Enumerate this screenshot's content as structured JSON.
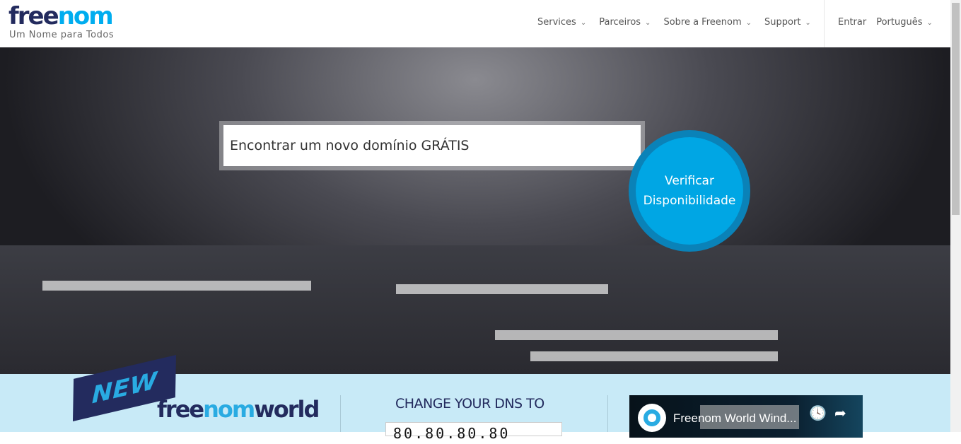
{
  "header": {
    "logo_part1": "free",
    "logo_part2": "nom",
    "tagline": "Um Nome para Todos",
    "nav": [
      {
        "label": "Services"
      },
      {
        "label": "Parceiros"
      },
      {
        "label": "Sobre a Freenom"
      },
      {
        "label": "Support"
      }
    ],
    "login": "Entrar",
    "language": "Português",
    "chevron": "⌄"
  },
  "hero": {
    "search_placeholder": "Encontrar um novo domínio GRÁTIS",
    "verify_line1": "Verificar",
    "verify_line2": "Disponibilidade"
  },
  "bottom": {
    "new_badge": "NEW",
    "world_part1": "free",
    "world_part2": "nom",
    "world_part3": "world",
    "dns_heading": "CHANGE YOUR DNS TO",
    "dns_value": "80.80.80.80",
    "video_title": "Freenom World Wind...",
    "clock_icon": "🕓",
    "share_icon": "➦"
  },
  "colors": {
    "brand_dark": "#232b5e",
    "brand_blue": "#00adef",
    "band": "#c8eaf7"
  }
}
